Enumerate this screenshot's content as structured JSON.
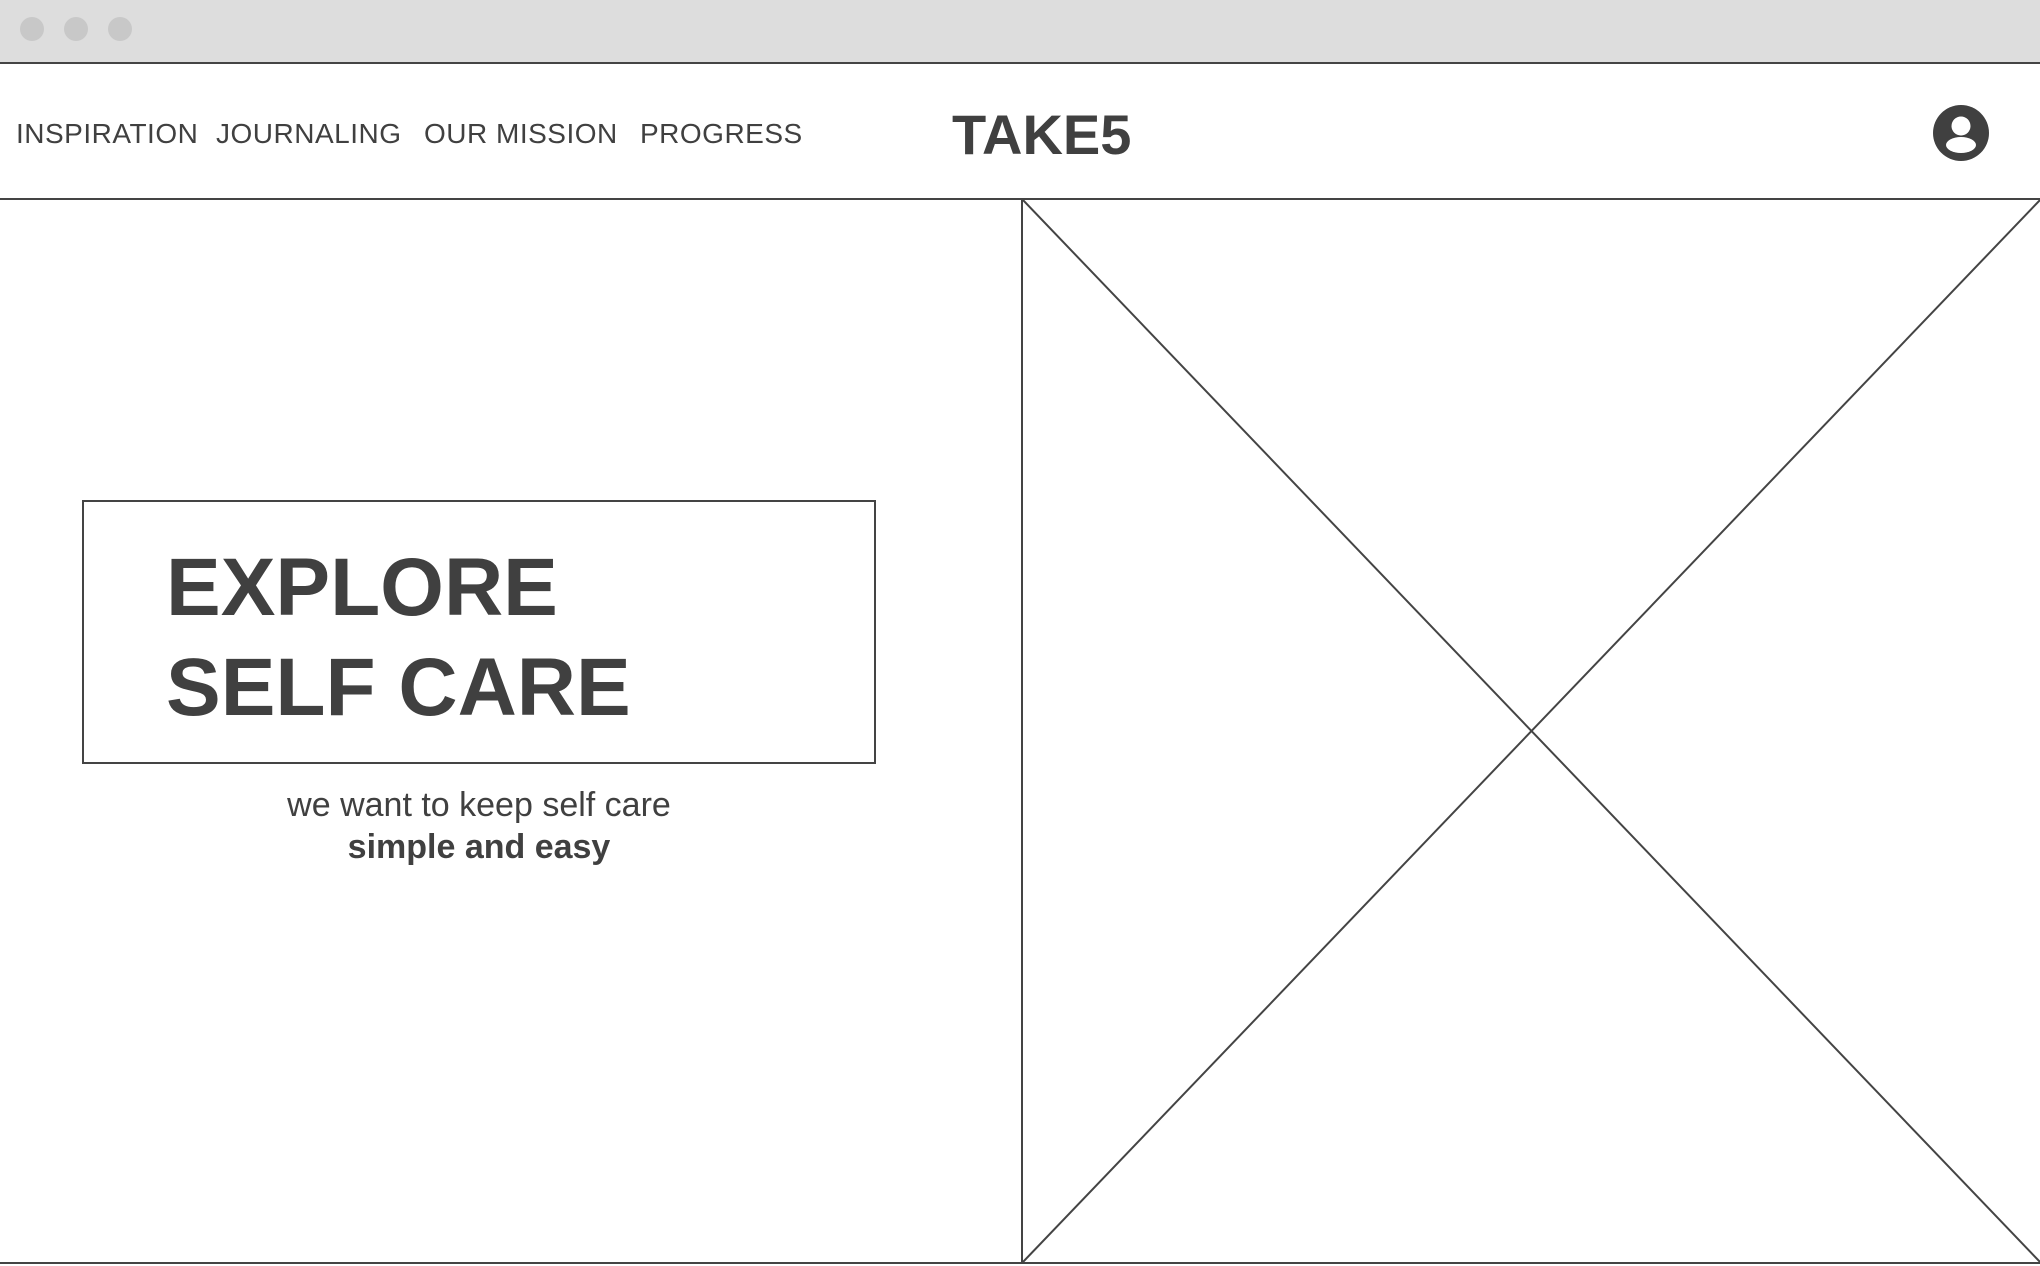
{
  "window": {
    "controls": [
      "close",
      "minimize",
      "maximize"
    ]
  },
  "header": {
    "nav": [
      {
        "label": "INSPIRATION"
      },
      {
        "label": "JOURNALING"
      },
      {
        "label": "OUR MISSION"
      },
      {
        "label": "PROGRESS"
      }
    ],
    "brand": "TAKE5",
    "profile_icon": "user-circle-icon"
  },
  "hero": {
    "title_line1": "EXPLORE",
    "title_line2": "SELF CARE",
    "tagline_plain": "we want to keep self care",
    "tagline_emphasis": "simple and easy"
  },
  "image_placeholder": {
    "icon": "image-placeholder-icon"
  },
  "colors": {
    "text": "#404040",
    "border": "#444444",
    "titlebar": "#dddddd",
    "window_dots": "#c8c8c8"
  }
}
